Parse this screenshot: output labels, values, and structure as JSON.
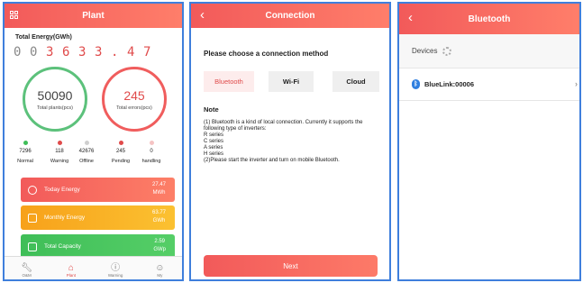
{
  "plant": {
    "title": "Plant",
    "total_energy_label": "Total Energy(GWh)",
    "digits": [
      "0",
      "0",
      "3",
      "6",
      "3",
      "3",
      ".",
      "4",
      "7"
    ],
    "plants_value": "50090",
    "plants_label": "Total plants(pcs)",
    "errors_value": "245",
    "errors_label": "Total errors(pcs)",
    "stats": [
      {
        "value": "7296",
        "name": "Normal",
        "color": "#3fbe58"
      },
      {
        "value": "118",
        "name": "Warning",
        "color": "#e04b4b"
      },
      {
        "value": "42676",
        "name": "Offline",
        "color": "#cfcfcf"
      },
      {
        "value": "245",
        "name": "Pending",
        "color": "#e04b4b"
      },
      {
        "value": "0",
        "name": "handling",
        "color": "#f5c4c4"
      }
    ],
    "cards": [
      {
        "title": "Today Energy",
        "value": "27.47",
        "unit": "MWh",
        "icon": "clock-icon"
      },
      {
        "title": "Monthly Energy",
        "value": "63.77",
        "unit": "GWh",
        "icon": "calendar-icon"
      },
      {
        "title": "Total Capacity",
        "value": "2.59",
        "unit": "GWp",
        "icon": "battery-icon"
      }
    ],
    "tabs": [
      {
        "label": "O&M",
        "icon": "wrench-icon"
      },
      {
        "label": "Plant",
        "icon": "home-icon"
      },
      {
        "label": "Warning",
        "icon": "alert-icon"
      },
      {
        "label": "My",
        "icon": "person-icon"
      }
    ]
  },
  "connection": {
    "title": "Connection",
    "prompt": "Please choose a connection method",
    "methods": [
      "Bluetooth",
      "Wi-Fi",
      "Cloud"
    ],
    "note_title": "Note",
    "note_text": "(1) Bluetooth is a kind of local connection. Currently it supports the following type of inverters:\nR series\nC series\nA series\nH series\n(2)Please start the inverter and turn on mobile Bluetooth.",
    "next_label": "Next"
  },
  "bluetooth": {
    "title": "Bluetooth",
    "devices_label": "Devices",
    "device_name": "BlueLink:00006"
  }
}
